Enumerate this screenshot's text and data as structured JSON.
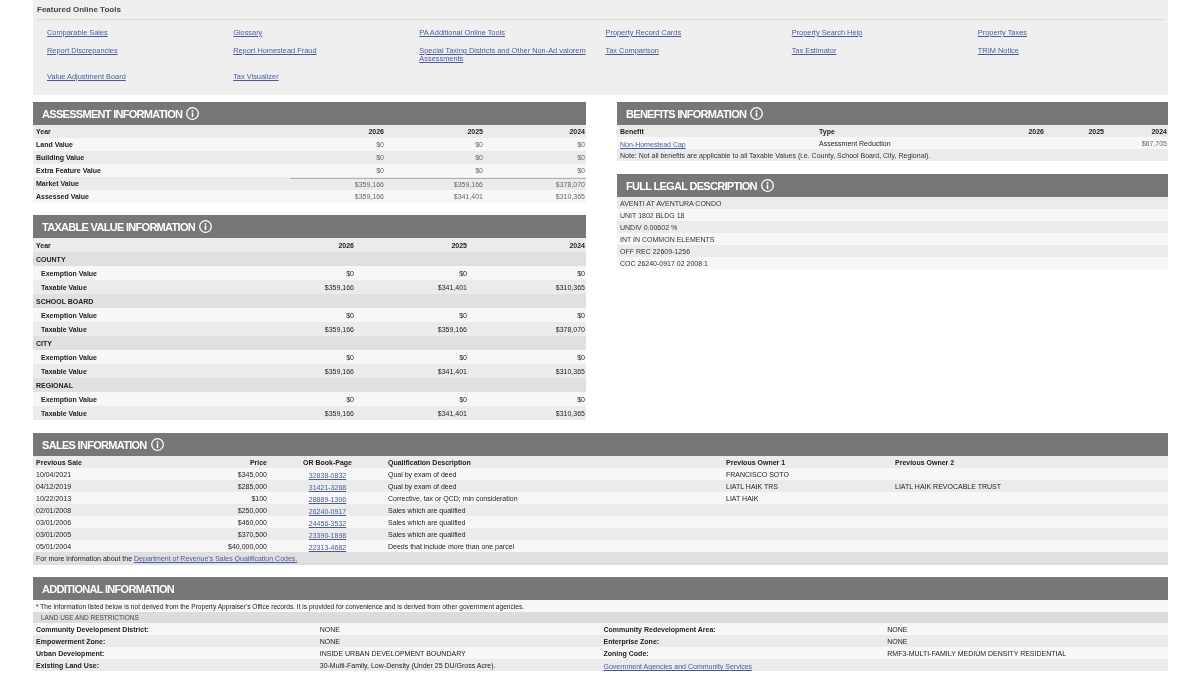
{
  "featured_tools": {
    "title": "Featured Online Tools",
    "links": [
      "Comparable Sales",
      "Glossary",
      "PA Additional Online Tools",
      "Property Record Cards",
      "Property Search Help",
      "Property Taxes",
      "Report Discrepancies",
      "Report Homestead Fraud",
      "Special Taxing Districts and Other Non-Ad valorem Assessments",
      "Tax Comparison",
      "Tax Estimator",
      "TRIM Notice",
      "Value Adjustment Board",
      "Tax Visualizer"
    ]
  },
  "assessment_information": {
    "title": "ASSESSMENT INFORMATION",
    "info_icon": true,
    "columns": [
      "Year",
      "2026",
      "2025",
      "2024"
    ],
    "rows": [
      {
        "kind": "value",
        "label": "Land Value",
        "values": [
          "$0",
          "$0",
          "$0"
        ]
      },
      {
        "kind": "value",
        "label": "Building Value",
        "values": [
          "$0",
          "$0",
          "$0"
        ]
      },
      {
        "kind": "value",
        "label": "Extra Feature Value",
        "values": [
          "$0",
          "$0",
          "$0"
        ]
      },
      {
        "kind": "total",
        "label": "Market Value",
        "values": [
          "$359,166",
          "$359,166",
          "$378,070"
        ]
      },
      {
        "kind": "value",
        "label": "Assessed Value",
        "values": [
          "$359,166",
          "$341,401",
          "$310,365"
        ]
      }
    ]
  },
  "taxable_value_information": {
    "title": "TAXABLE VALUE INFORMATION",
    "info_icon": true,
    "columns": [
      "Year",
      "2026",
      "2025",
      "2024"
    ],
    "groups": [
      {
        "name": "COUNTY",
        "rows": [
          {
            "label": "Exemption Value",
            "values": [
              "$0",
              "$0",
              "$0"
            ]
          },
          {
            "label": "Taxable Value",
            "values": [
              "$359,166",
              "$341,401",
              "$310,365"
            ]
          }
        ]
      },
      {
        "name": "SCHOOL BOARD",
        "rows": [
          {
            "label": "Exemption Value",
            "values": [
              "$0",
              "$0",
              "$0"
            ]
          },
          {
            "label": "Taxable Value",
            "values": [
              "$359,166",
              "$359,166",
              "$378,070"
            ]
          }
        ]
      },
      {
        "name": "CITY",
        "rows": [
          {
            "label": "Exemption Value",
            "values": [
              "$0",
              "$0",
              "$0"
            ]
          },
          {
            "label": "Taxable Value",
            "values": [
              "$359,166",
              "$341,401",
              "$310,365"
            ]
          }
        ]
      },
      {
        "name": "REGIONAL",
        "rows": [
          {
            "label": "Exemption Value",
            "values": [
              "$0",
              "$0",
              "$0"
            ]
          },
          {
            "label": "Taxable Value",
            "values": [
              "$359,166",
              "$341,401",
              "$310,365"
            ]
          }
        ]
      }
    ]
  },
  "benefits_information": {
    "title": "BENEFITS INFORMATION",
    "info_icon": true,
    "columns": [
      "Benefit",
      "Type",
      "2026",
      "2025",
      "2024"
    ],
    "rows": [
      {
        "benefit": "Non-Homestead Cap",
        "type": "Assessment Reduction",
        "value_2024": "$67,705"
      }
    ],
    "note": "Note: Not all benefits are applicable to all Taxable Values (i.e. County, School Board, City, Regional)."
  },
  "full_legal_description": {
    "title": "FULL LEGAL DESCRIPTION",
    "info_icon": true,
    "lines": [
      "AVENTI AT AVENTURA CONDO",
      "UNIT 1802 BLDG 18",
      "UNDIV 0.00602 %",
      "INT IN COMMON ELEMENTS",
      "OFF REC 22609-1256",
      "COC 26240-0917 02 2008 1"
    ]
  },
  "sales_information": {
    "title": "SALES INFORMATION",
    "info_icon": true,
    "columns": [
      "Previous Sale",
      "Price",
      "OR Book-Page",
      "Qualification Description",
      "Previous Owner 1",
      "Previous Owner 2"
    ],
    "rows": [
      {
        "previous_sale": "10/04/2021",
        "price": "$345,000",
        "or_book_page": "32838-0832",
        "qualification_description": "Qual by exam of deed",
        "previous_owner_1": "FRANCISCO SOTO"
      },
      {
        "previous_sale": "04/12/2019",
        "price": "$285,000",
        "or_book_page": "31421-3268",
        "qualification_description": "Qual by exam of deed",
        "previous_owner_1": "LIATL HAIK TRS",
        "previous_owner_2": "LIATL HAIK REVOCABLE TRUST"
      },
      {
        "previous_sale": "10/22/2013",
        "price": "$100",
        "or_book_page": "28889-1306",
        "qualification_description": "Corrective, tax or QCD; min consideration",
        "previous_owner_1": "LIAT HAIK"
      },
      {
        "previous_sale": "02/01/2008",
        "price": "$250,000",
        "or_book_page": "26240-0917",
        "qualification_description": "Sales which are qualified"
      },
      {
        "previous_sale": "03/01/2006",
        "price": "$460,000",
        "or_book_page": "24456-3532",
        "qualification_description": "Sales which are qualified"
      },
      {
        "previous_sale": "03/01/2005",
        "price": "$370,500",
        "or_book_page": "23390-1898",
        "qualification_description": "Sales which are qualified"
      },
      {
        "previous_sale": "05/01/2004",
        "price": "$40,000,000",
        "or_book_page": "22313-4682",
        "qualification_description": "Deeds that include more than one parcel"
      }
    ],
    "footer": {
      "text": "For more information about the",
      "link": "Department of Revenue's Sales Qualification Codes."
    }
  },
  "additional_information": {
    "title": "ADDITIONAL INFORMATION",
    "info_icon": false,
    "note": "* The information listed below is not derived from the Property Appraiser's Office records. It is provided for convenience and is derived from other government agencies.",
    "subheading": "LAND USE AND RESTRICTIONS",
    "rows": [
      {
        "cells": [
          {
            "kind": "label",
            "text": "Community Development District:"
          },
          {
            "kind": "value",
            "text": "NONE"
          },
          {
            "kind": "label",
            "text": "Community Redevelopment Area:"
          },
          {
            "kind": "value",
            "text": "NONE"
          }
        ]
      },
      {
        "cells": [
          {
            "kind": "label",
            "text": "Empowerment Zone:"
          },
          {
            "kind": "value",
            "text": "NONE"
          },
          {
            "kind": "label",
            "text": "Enterprise Zone:"
          },
          {
            "kind": "value",
            "text": "NONE"
          }
        ]
      },
      {
        "cells": [
          {
            "kind": "label",
            "text": "Urban Development:"
          },
          {
            "kind": "value",
            "text": "INSIDE URBAN DEVELOPMENT BOUNDARY"
          },
          {
            "kind": "label",
            "text": "Zoning Code:"
          },
          {
            "kind": "value",
            "text": "RMF3-MULTI-FAMILY MEDIUM DENSITY RESIDENTIAL"
          }
        ]
      },
      {
        "cells": [
          {
            "kind": "label",
            "text": "Existing Land Use:"
          },
          {
            "kind": "value",
            "text": "30-Multi-Family, Low-Density (Under 25 DU/Gross Acre)."
          },
          {
            "kind": "link",
            "text": "Government Agencies and Community Services"
          }
        ]
      }
    ]
  }
}
